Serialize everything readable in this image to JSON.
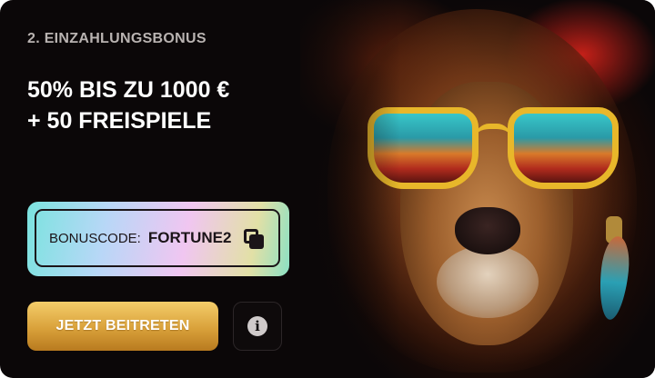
{
  "promo": {
    "eyebrow": "2. EINZAHLUNGSBONUS",
    "headline_line1": "50% BIS ZU 1000 €",
    "headline_line2": "+ 50 FREISPIELE"
  },
  "bonus_code": {
    "label": "BONUSCODE:",
    "value": "FORTUNE2",
    "copy_icon": "copy-icon"
  },
  "actions": {
    "join_label": "JETZT BEITRETEN",
    "info_icon": "info-icon",
    "info_glyph": "i"
  },
  "hero_image": {
    "subject": "lion-with-sunglasses",
    "colors": {
      "accent_red": "#ff281e",
      "mane": "#9b5e2c",
      "glasses_frame": "#e8b72a"
    }
  },
  "colors": {
    "card_background": "#0b0708",
    "eyebrow_text": "#b9b3b1",
    "headline_text": "#ffffff",
    "join_button_top": "#f4cd6a",
    "join_button_bottom": "#b87a1f",
    "code_gradient_start": "#7be3df",
    "code_gradient_end": "#8be0c4"
  }
}
